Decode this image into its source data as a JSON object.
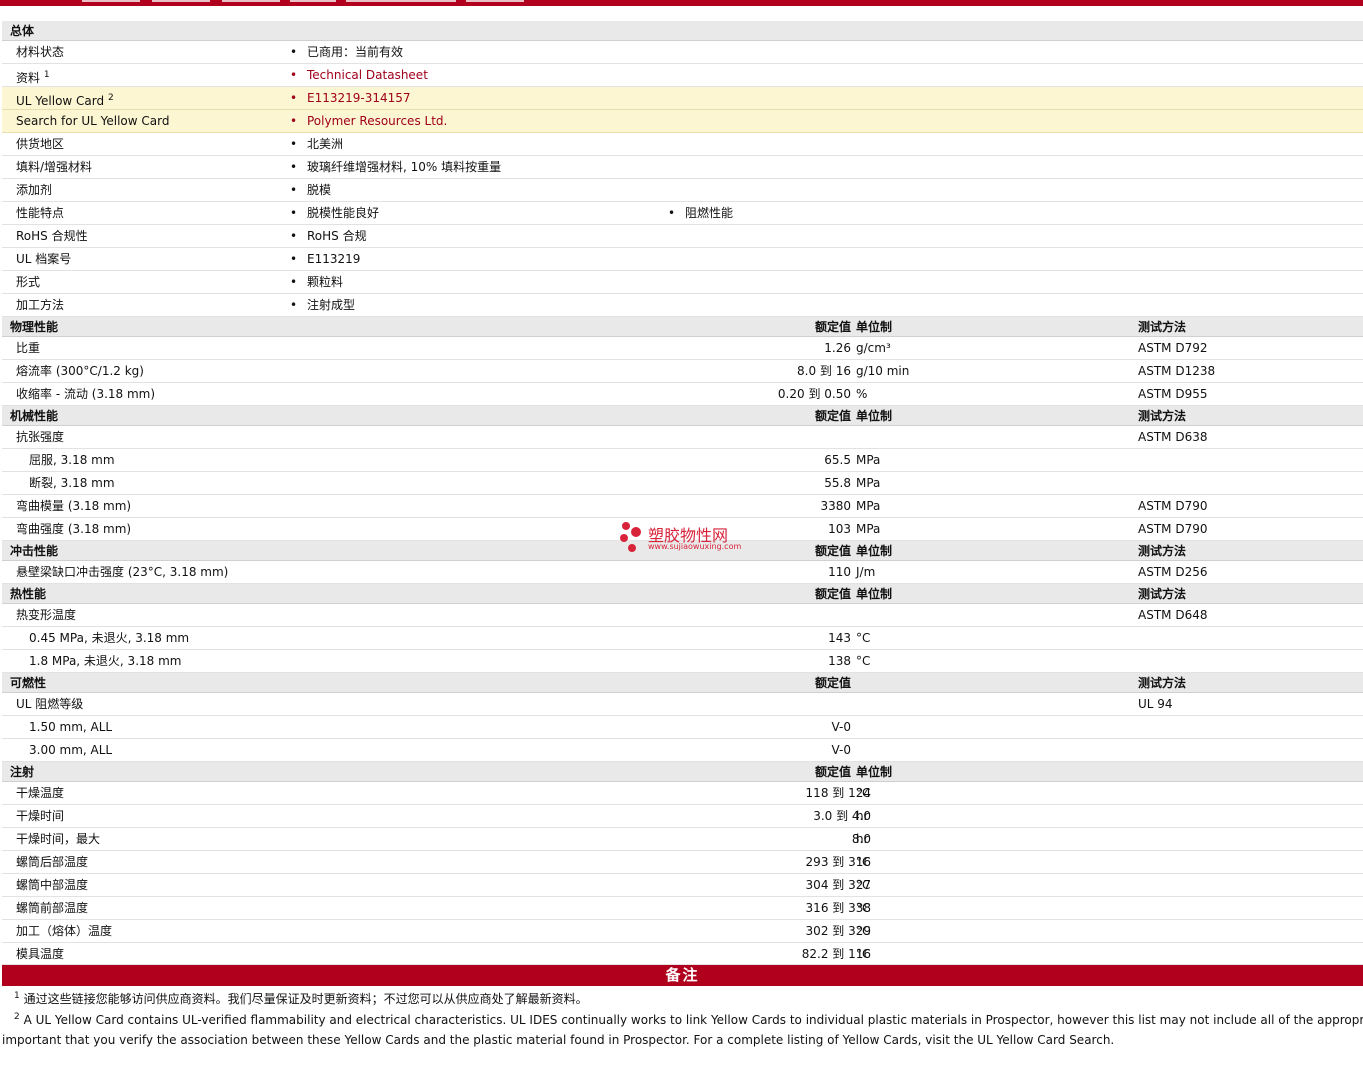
{
  "general": {
    "section": "总体",
    "rows": [
      {
        "label": "材料状态",
        "value": "已商用：当前有效"
      },
      {
        "label": "资料",
        "sup": "1",
        "value": "Technical Datasheet"
      },
      {
        "label": "UL Yellow Card",
        "sup": "2",
        "value": "E113219-314157"
      },
      {
        "label": "Search for UL Yellow Card",
        "value": "Polymer Resources Ltd."
      },
      {
        "label": "供货地区",
        "value": "北美洲"
      },
      {
        "label": "填料/增强材料",
        "value": "玻璃纤维增强材料, 10% 填料按重量"
      },
      {
        "label": "添加剂",
        "value": "脱模"
      },
      {
        "label": "性能特点",
        "value": "脱模性能良好",
        "value2": "阻燃性能"
      },
      {
        "label": "RoHS 合规性",
        "value": "RoHS 合规"
      },
      {
        "label": "UL 档案号",
        "value": "E113219"
      },
      {
        "label": "形式",
        "value": "颗粒料"
      },
      {
        "label": "加工方法",
        "value": "注射成型"
      }
    ]
  },
  "headers": {
    "nominal": "额定值",
    "unit": "单位制",
    "method": "测试方法"
  },
  "physical": {
    "section": "物理性能",
    "rows": [
      {
        "label": "比重",
        "value": "1.26",
        "unit": "g/cm³",
        "method": "ASTM D792"
      },
      {
        "label": "熔流率  (300°C/1.2 kg)",
        "value": "8.0 到   16",
        "unit": "g/10 min",
        "method": "ASTM D1238"
      },
      {
        "label": "收缩率  - 流动  (3.18 mm)",
        "value": "0.20 到  0.50",
        "unit": "%",
        "method": "ASTM D955"
      }
    ]
  },
  "mechanical": {
    "section": "机械性能",
    "rows": [
      {
        "label": "抗张强度",
        "value": "",
        "unit": "",
        "method": "ASTM D638"
      },
      {
        "label": "屈服, 3.18 mm",
        "value": "65.5",
        "unit": "MPa",
        "method": ""
      },
      {
        "label": "断裂, 3.18 mm",
        "value": "55.8",
        "unit": "MPa",
        "method": ""
      },
      {
        "label": "弯曲模量  (3.18 mm)",
        "value": "3380",
        "unit": "MPa",
        "method": "ASTM D790"
      },
      {
        "label": "弯曲强度  (3.18 mm)",
        "value": "103",
        "unit": "MPa",
        "method": "ASTM D790"
      }
    ]
  },
  "impact": {
    "section": "冲击性能",
    "rows": [
      {
        "label": "悬壁梁缺口冲击强度  (23°C, 3.18 mm)",
        "value": "110",
        "unit": "J/m",
        "method": "ASTM D256"
      }
    ]
  },
  "thermal": {
    "section": "热性能",
    "rows": [
      {
        "label": "热变形温度",
        "value": "",
        "unit": "",
        "method": "ASTM D648"
      },
      {
        "label": "0.45 MPa, 未退火, 3.18 mm",
        "value": "143",
        "unit": "°C",
        "method": ""
      },
      {
        "label": "1.8 MPa, 未退火, 3.18 mm",
        "value": "138",
        "unit": "°C",
        "method": ""
      }
    ]
  },
  "flammability": {
    "section": "可燃性",
    "rows": [
      {
        "label": "UL 阻燃等级",
        "value": "",
        "method": "UL 94"
      },
      {
        "label": "1.50 mm, ALL",
        "value": "V-0",
        "method": ""
      },
      {
        "label": "3.00 mm, ALL",
        "value": "V-0",
        "method": ""
      }
    ]
  },
  "injection": {
    "section": "注射",
    "rows": [
      {
        "label": "干燥温度",
        "value": "118 到   124",
        "unit": "°C"
      },
      {
        "label": "干燥时间",
        "value": "3.0 到   4.0",
        "unit": "hr"
      },
      {
        "label": "干燥时间，最大",
        "value": "8.0",
        "unit": "hr"
      },
      {
        "label": "螺筒后部温度",
        "value": "293 到   316",
        "unit": "°C"
      },
      {
        "label": "螺筒中部温度",
        "value": "304 到   327",
        "unit": "°C"
      },
      {
        "label": "螺筒前部温度",
        "value": "316 到   338",
        "unit": "°C"
      },
      {
        "label": "加工（熔体）温度",
        "value": "302 到   329",
        "unit": "°C"
      },
      {
        "label": "模具温度",
        "value": "82.2 到   116",
        "unit": "°C"
      }
    ]
  },
  "notes": {
    "title": "备注",
    "fn1_num": "1",
    "fn1": "通过这些链接您能够访问供应商资料。我们尽量保证及时更新资料；不过您可以从供应商处了解最新资料。",
    "fn2_num": "2",
    "fn2_line1": "A UL Yellow Card contains UL-verified flammability and electrical characteristics. UL IDES continually works to link Yellow Cards to individual plastic materials in Prospector, however this list may not include all of the appropriate links.",
    "fn2_line2": "important that you verify the association between these Yellow Cards and the plastic material found in Prospector. For a complete listing of Yellow Cards, visit the UL Yellow Card Search."
  },
  "watermark": {
    "title": "塑胶物性网",
    "url": "www.sujiaowuxing.com"
  },
  "colors": {
    "brand": "#b0001e",
    "link": "#a0001a",
    "highlight": "#fdf6d2"
  }
}
